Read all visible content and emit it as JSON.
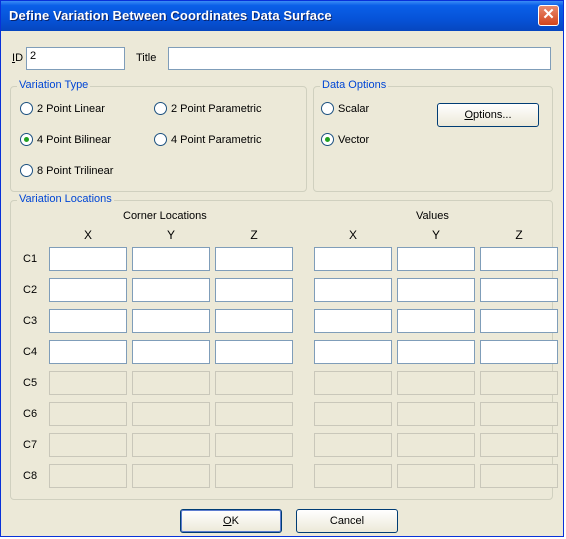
{
  "window": {
    "title": "Define Variation Between Coordinates Data Surface",
    "close_glyph": "✕"
  },
  "id_field": {
    "label_u": "I",
    "label_rest": "D",
    "value": "2"
  },
  "title_field": {
    "label": "Title",
    "value": ""
  },
  "variation_type": {
    "title": "Variation Type",
    "options": [
      {
        "label": "2 Point Linear",
        "checked": false
      },
      {
        "label": "2 Point Parametric",
        "checked": false
      },
      {
        "label": "4 Point Bilinear",
        "checked": true
      },
      {
        "label": "4 Point Parametric",
        "checked": false
      },
      {
        "label": "8 Point Trilinear",
        "checked": false
      }
    ]
  },
  "data_options": {
    "title": "Data Options",
    "options": [
      {
        "label": "Scalar",
        "checked": false
      },
      {
        "label": "Vector",
        "checked": true
      }
    ],
    "options_button_u": "O",
    "options_button_rest": "ptions..."
  },
  "variation_locations": {
    "title": "Variation Locations",
    "corner_header": "Corner Locations",
    "values_header": "Values",
    "columns": [
      "X",
      "Y",
      "Z"
    ],
    "rows": [
      "C1",
      "C2",
      "C3",
      "C4",
      "C5",
      "C6",
      "C7",
      "C8"
    ],
    "enabled_rows": 4
  },
  "buttons": {
    "ok_u": "O",
    "ok_rest": "K",
    "cancel": "Cancel"
  }
}
